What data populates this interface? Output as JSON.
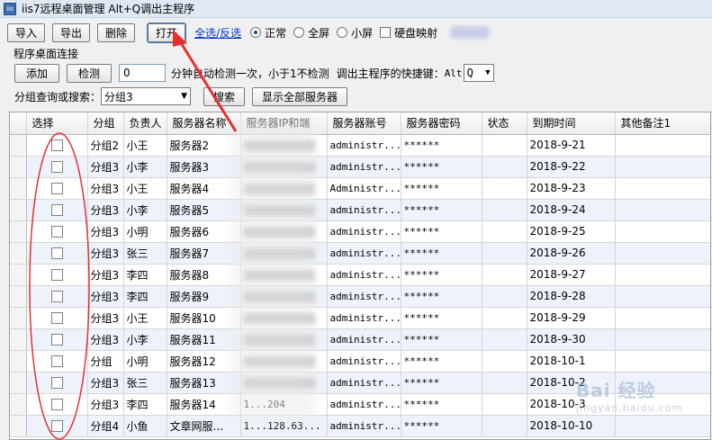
{
  "window": {
    "title": "iis7远程桌面管理 Alt+Q调出主程序"
  },
  "toolbar": {
    "import_label": "导入",
    "export_label": "导出",
    "delete_label": "删除",
    "open_label": "打开",
    "select_all_label": "全选/反选",
    "mode_normal": "正常",
    "mode_fullscreen": "全屏",
    "mode_small": "小屏",
    "disk_map_label": "硬盘映射"
  },
  "program_connect": {
    "section_label": "程序桌面连接",
    "add_label": "添加",
    "detect_label": "检测",
    "interval_value": "0",
    "interval_text": "分钟自动检测一次，小于1不检测",
    "hotkey_label": "调出主程序的快捷键：",
    "hotkey_prefix": "Alt",
    "hotkey_value": "Q"
  },
  "search": {
    "label": "分组查询或搜索：",
    "group_value": "分组3",
    "search_label": "搜索",
    "show_all_label": "显示全部服务器"
  },
  "table": {
    "columns": [
      "选择",
      "分组",
      "负责人",
      "服务器名称",
      "服务器IP和端",
      "服务器账号",
      "服务器密码",
      "状态",
      "到期时间",
      "其他备注1"
    ],
    "rows": [
      {
        "group": "分组2",
        "owner": "小王",
        "name": "服务器2",
        "ip": "",
        "account": "administr...",
        "password": "******",
        "status": "",
        "expire": "2018-9-21",
        "note": ""
      },
      {
        "group": "分组3",
        "owner": "小李",
        "name": "服务器3",
        "ip": "",
        "account": "administr...",
        "password": "******",
        "status": "",
        "expire": "2018-9-22",
        "note": ""
      },
      {
        "group": "分组3",
        "owner": "小王",
        "name": "服务器4",
        "ip": "",
        "account": "Administr...",
        "password": "******",
        "status": "",
        "expire": "2018-9-23",
        "note": ""
      },
      {
        "group": "分组3",
        "owner": "小李",
        "name": "服务器5",
        "ip": "",
        "account": "administr...",
        "password": "******",
        "status": "",
        "expire": "2018-9-24",
        "note": ""
      },
      {
        "group": "分组3",
        "owner": "小明",
        "name": "服务器6",
        "ip": "",
        "account": "administr...",
        "password": "******",
        "status": "",
        "expire": "2018-9-25",
        "note": ""
      },
      {
        "group": "分组3",
        "owner": "张三",
        "name": "服务器7",
        "ip": "",
        "account": "administr...",
        "password": "******",
        "status": "",
        "expire": "2018-9-26",
        "note": ""
      },
      {
        "group": "分组3",
        "owner": "李四",
        "name": "服务器8",
        "ip": "",
        "account": "administr...",
        "password": "******",
        "status": "",
        "expire": "2018-9-27",
        "note": ""
      },
      {
        "group": "分组3",
        "owner": "李四",
        "name": "服务器9",
        "ip": "",
        "account": "administr...",
        "password": "******",
        "status": "",
        "expire": "2018-9-28",
        "note": ""
      },
      {
        "group": "分组3",
        "owner": "小王",
        "name": "服务器10",
        "ip": "",
        "account": "administr...",
        "password": "******",
        "status": "",
        "expire": "2018-9-29",
        "note": ""
      },
      {
        "group": "分组3",
        "owner": "小李",
        "name": "服务器11",
        "ip": "",
        "account": "administr...",
        "password": "******",
        "status": "",
        "expire": "2018-9-30",
        "note": ""
      },
      {
        "group": "分组",
        "owner": "小明",
        "name": "服务器12",
        "ip": "",
        "account": "administr...",
        "password": "******",
        "status": "",
        "expire": "2018-10-1",
        "note": ""
      },
      {
        "group": "分组3",
        "owner": "张三",
        "name": "服务器13",
        "ip": "",
        "account": "administr...",
        "password": "******",
        "status": "",
        "expire": "2018-10-2",
        "note": ""
      },
      {
        "group": "分组3",
        "owner": "李四",
        "name": "服务器14",
        "ip": "1...204",
        "account": "administr...",
        "password": "******",
        "status": "",
        "expire": "2018-10-3",
        "note": ""
      },
      {
        "group": "分组4",
        "owner": "小鱼",
        "name": "文章网服...",
        "ip": "1...128.63...",
        "account": "administr...",
        "password": "******",
        "status": "",
        "expire": "2018-10-10",
        "note": ""
      }
    ]
  },
  "annotations": {
    "accent": "#e53030"
  },
  "watermark": {
    "text": "Bai 经验",
    "sub": "jingyan.baidu.com"
  }
}
